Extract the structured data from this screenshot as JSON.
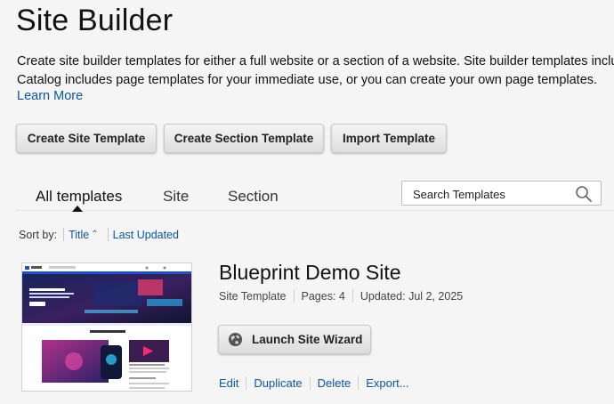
{
  "header": {
    "title": "Site Builder",
    "description_line1": "Create site builder templates for either a full website or a section of a website. Site builder templates include pages,",
    "description_line2": "Catalog includes page templates for your immediate use, or you can create your own page templates.",
    "learn_more": "Learn More"
  },
  "toolbar": {
    "create_site_template": "Create Site Template",
    "create_section_template": "Create Section Template",
    "import_template": "Import Template"
  },
  "tabs": {
    "all": "All templates",
    "site": "Site",
    "section": "Section",
    "active": "All templates"
  },
  "search": {
    "placeholder": "Search Templates"
  },
  "sort": {
    "label": "Sort by:",
    "title": "Title",
    "last_updated": "Last Updated"
  },
  "template": {
    "title": "Blueprint Demo Site",
    "type": "Site Template",
    "pages": "Pages: 4",
    "updated": "Updated: Jul 2, 2025",
    "launch_button": "Launch Site Wizard",
    "actions": {
      "edit": "Edit",
      "duplicate": "Duplicate",
      "delete": "Delete",
      "export": "Export..."
    },
    "thumbnail": {
      "brand": "Nexus",
      "hero_heading": "Welcome to Nexus",
      "section_heading": "Get to know Nexus."
    }
  },
  "colors": {
    "link": "#0b57a4",
    "thumbnail_accent": "#1f4fd1"
  }
}
